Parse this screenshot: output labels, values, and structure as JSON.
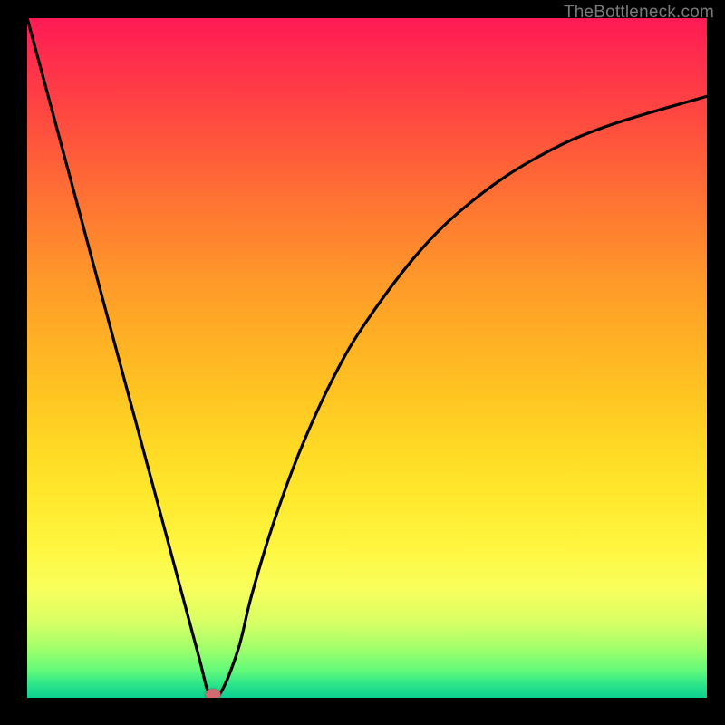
{
  "watermark": "TheBottleneck.com",
  "colors": {
    "frame": "#000000",
    "curve": "#000000",
    "marker": "#cf6a73"
  },
  "chart_data": {
    "type": "line",
    "title": "",
    "xlabel": "",
    "ylabel": "",
    "xlim": [
      0,
      100
    ],
    "ylim": [
      0,
      100
    ],
    "grid": false,
    "legend": false,
    "series": [
      {
        "name": "bottleneck-curve",
        "x": [
          0,
          6.25,
          12.5,
          18.75,
          25,
          26.7,
          28.3,
          31,
          33,
          36,
          40,
          45,
          50,
          58,
          66,
          75,
          85,
          100
        ],
        "y": [
          100,
          76.8,
          53.5,
          30.3,
          7.0,
          0.8,
          0.5,
          7.0,
          15.0,
          25.0,
          36.0,
          47.0,
          55.5,
          66.0,
          73.5,
          79.5,
          84.0,
          88.5
        ]
      }
    ],
    "min_point": {
      "x": 27.3,
      "y": 0.5
    },
    "note": "Values estimated from pixel positions; no axis ticks/labels present in source image."
  }
}
